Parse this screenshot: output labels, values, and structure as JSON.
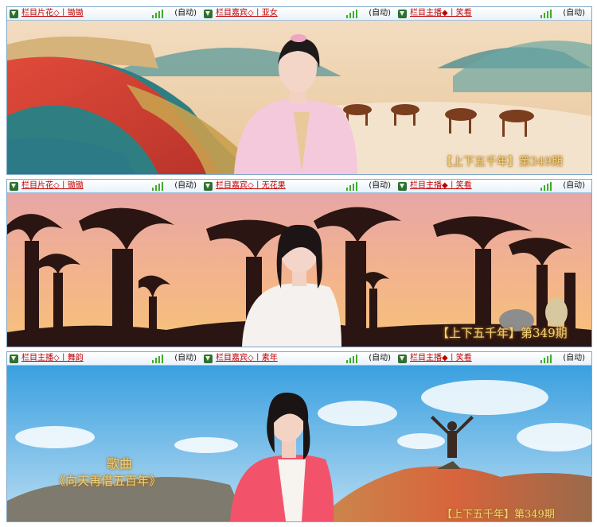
{
  "panels": [
    {
      "tabs": [
        {
          "title": "栏目片花◇丨锄锄",
          "mode": "(自动)"
        },
        {
          "title": "栏目嘉宾◇丨亚女",
          "mode": "(自动)"
        },
        {
          "title": "栏目主播◆丨笑看",
          "mode": "(自动)"
        }
      ],
      "caption": "【上下五千年】第349期"
    },
    {
      "tabs": [
        {
          "title": "栏目片花◇丨锄锄",
          "mode": "(自动)"
        },
        {
          "title": "栏目嘉宾◇丨无花果",
          "mode": "(自动)"
        },
        {
          "title": "栏目主播◆丨笑看",
          "mode": "(自动)"
        }
      ],
      "caption": "【上下五千年】第349期"
    },
    {
      "tabs": [
        {
          "title": "栏目主播◇丨舞韵",
          "mode": "(自动)"
        },
        {
          "title": "栏目嘉宾◇丨素年",
          "mode": "(自动)"
        },
        {
          "title": "栏目主播◆丨笑看",
          "mode": "(自动)"
        }
      ],
      "song_label": "歌曲",
      "song_title": "《向天再借五百年》",
      "caption": "【上下五千年】第349期"
    }
  ]
}
